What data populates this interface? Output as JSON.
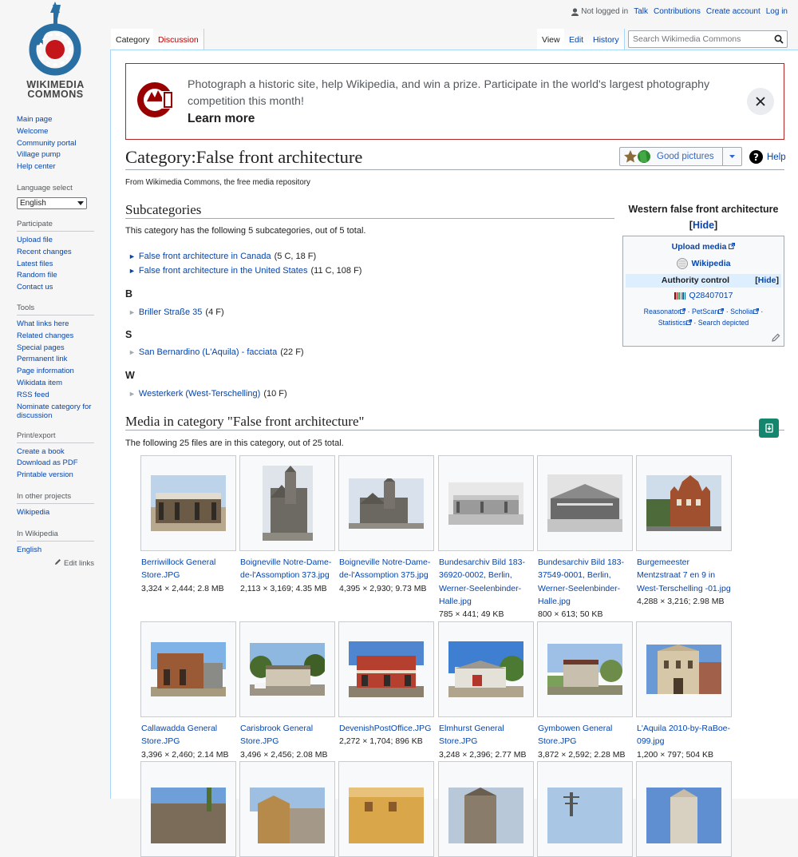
{
  "personal": {
    "not_logged_in": "Not logged in",
    "talk": "Talk",
    "contributions": "Contributions",
    "create_account": "Create account",
    "log_in": "Log in"
  },
  "tabs": {
    "category": "Category",
    "discussion": "Discussion",
    "view": "View",
    "edit": "Edit",
    "history": "History"
  },
  "search": {
    "placeholder": "Search Wikimedia Commons"
  },
  "logo": {
    "line1": "WIKIMEDIA",
    "line2": "COMMONS"
  },
  "sidebar": {
    "nav": [
      "Main page",
      "Welcome",
      "Community portal",
      "Village pump",
      "Help center"
    ],
    "language_select_heading": "Language select",
    "language_value": "English",
    "participate_heading": "Participate",
    "participate": [
      "Upload file",
      "Recent changes",
      "Latest files",
      "Random file",
      "Contact us"
    ],
    "tools_heading": "Tools",
    "tools": [
      "What links here",
      "Related changes",
      "Special pages",
      "Permanent link",
      "Page information",
      "Wikidata item",
      "RSS feed",
      "Nominate category for discussion"
    ],
    "print_heading": "Print/export",
    "print": [
      "Create a book",
      "Download as PDF",
      "Printable version"
    ],
    "other_projects_heading": "In other projects",
    "other_projects": [
      "Wikipedia"
    ],
    "in_wikipedia_heading": "In Wikipedia",
    "in_wikipedia": [
      "English"
    ],
    "edit_links": "Edit links"
  },
  "banner": {
    "message": "Photograph a historic site, help Wikipedia, and win a prize. Participate in the world's largest photography competition this month!",
    "learn_more": "Learn more"
  },
  "page": {
    "title": "Category:False front architecture",
    "tagline": "From Wikimedia Commons, the free media repository",
    "good_pictures": "Good pictures",
    "help": "Help"
  },
  "subcategories": {
    "heading": "Subcategories",
    "summary": "This category has the following 5 subcategories, out of 5 total.",
    "items": [
      {
        "name": "False front architecture in Canada",
        "count": "(5 C, 18 F)"
      },
      {
        "name": "False front architecture in the United States",
        "count": "(11 C, 108 F)"
      }
    ],
    "groups": [
      {
        "letter": "B",
        "name": "Briller Straße 35",
        "count": "(4 F)"
      },
      {
        "letter": "S",
        "name": "San Bernardino (L'Aquila) - facciata",
        "count": "(22 F)"
      },
      {
        "letter": "W",
        "name": "Westerkerk (West-Terschelling)",
        "count": "(10 F)"
      }
    ]
  },
  "infobox": {
    "title": "Western false front architecture",
    "hide": "Hide",
    "upload_media": "Upload media",
    "wikipedia": "Wikipedia",
    "authority_control": "Authority control",
    "qid": "Q28407017",
    "links1": [
      "Reasonator",
      "PetScan",
      "Scholia"
    ],
    "links2": [
      "Statistics",
      "Search depicted"
    ]
  },
  "media": {
    "heading": "Media in category \"False front architecture\"",
    "summary": "The following 25 files are in this category, out of 25 total.",
    "files": [
      {
        "name": "Berriwillock General Store.JPG",
        "meta": "3,324 × 2,444; 2.8 MB"
      },
      {
        "name": "Boigneville Notre-Dame-de-l'Assomption 373.jpg",
        "meta": "2,113 × 3,169; 4.35 MB"
      },
      {
        "name": "Boigneville Notre-Dame-de-l'Assomption 375.jpg",
        "meta": "4,395 × 2,930; 9.73 MB"
      },
      {
        "name": "Bundesarchiv Bild 183-36920-0002, Berlin, Werner-Seelenbinder-Halle.jpg",
        "meta": "785 × 441; 49 KB"
      },
      {
        "name": "Bundesarchiv Bild 183-37549-0001, Berlin, Werner-Seelenbinder-Halle.jpg",
        "meta": "800 × 613; 50 KB"
      },
      {
        "name": "Burgemeester Mentzstraat 7 en 9 in West-Terschelling -01.jpg",
        "meta": "4,288 × 3,216; 2.98 MB"
      },
      {
        "name": "Callawadda General Store.JPG",
        "meta": "3,396 × 2,460; 2.14 MB"
      },
      {
        "name": "Carisbrook General Store.JPG",
        "meta": "3,496 × 2,456; 2.08 MB"
      },
      {
        "name": "DevenishPostOffice.JPG",
        "meta": "2,272 × 1,704; 896 KB"
      },
      {
        "name": "Elmhurst General Store.JPG",
        "meta": "3,248 × 2,396; 2.77 MB"
      },
      {
        "name": "Gymbowen General Store.JPG",
        "meta": "3,872 × 2,592; 2.28 MB"
      },
      {
        "name": "L'Aquila 2010-by-RaBoe-099.jpg",
        "meta": "1,200 × 797; 504 KB"
      }
    ]
  }
}
